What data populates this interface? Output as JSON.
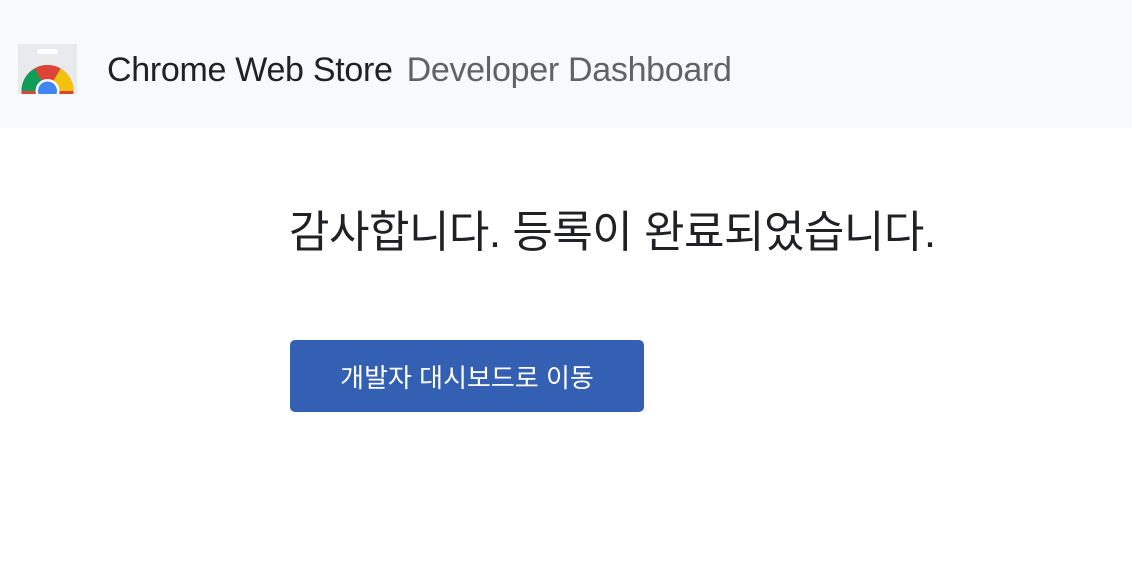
{
  "header": {
    "brand": "Chrome Web Store",
    "section": "Developer Dashboard",
    "logo_icon": "chrome-web-store-icon",
    "background": "#f8f9fa"
  },
  "main": {
    "message": "감사합니다. 등록이 완료되었습니다.",
    "button_label": "개발자 대시보드로 이동"
  },
  "colors": {
    "button": "#3460b4",
    "text_primary": "#202124",
    "text_secondary": "#5f6368"
  }
}
